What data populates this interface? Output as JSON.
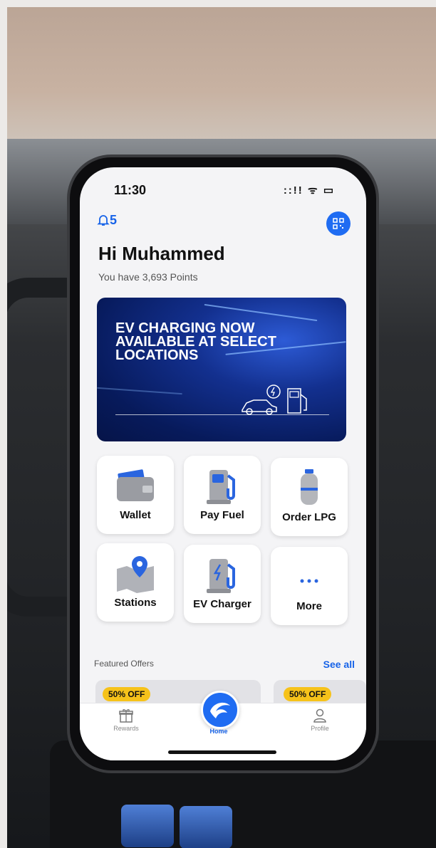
{
  "status": {
    "time": "11:30",
    "icons": "::!! ᯤ ▭"
  },
  "header": {
    "notification_count": "5",
    "greeting": "Hi Muhammed",
    "points": "You have 3,693 Points"
  },
  "banner": {
    "title": "EV CHARGING NOW AVAILABLE AT SELECT LOCATIONS"
  },
  "tiles": [
    {
      "label": "Wallet",
      "icon": "wallet-icon"
    },
    {
      "label": "Pay Fuel",
      "icon": "fuel-pump-icon"
    },
    {
      "label": "Order LPG",
      "icon": "gas-cylinder-icon"
    },
    {
      "label": "Stations",
      "icon": "map-pin-icon"
    },
    {
      "label": "EV Charger",
      "icon": "ev-charger-icon"
    },
    {
      "label": "More",
      "icon": "more-icon"
    }
  ],
  "featured": {
    "title": "Featured Offers",
    "see_all": "See all",
    "badge": "50% OFF"
  },
  "tabbar": {
    "rewards": "Rewards",
    "home": "Home",
    "profile": "Profile"
  },
  "colors": {
    "accent": "#1f6cf2",
    "badge": "#f6c21a",
    "banner": "#0b2474"
  }
}
